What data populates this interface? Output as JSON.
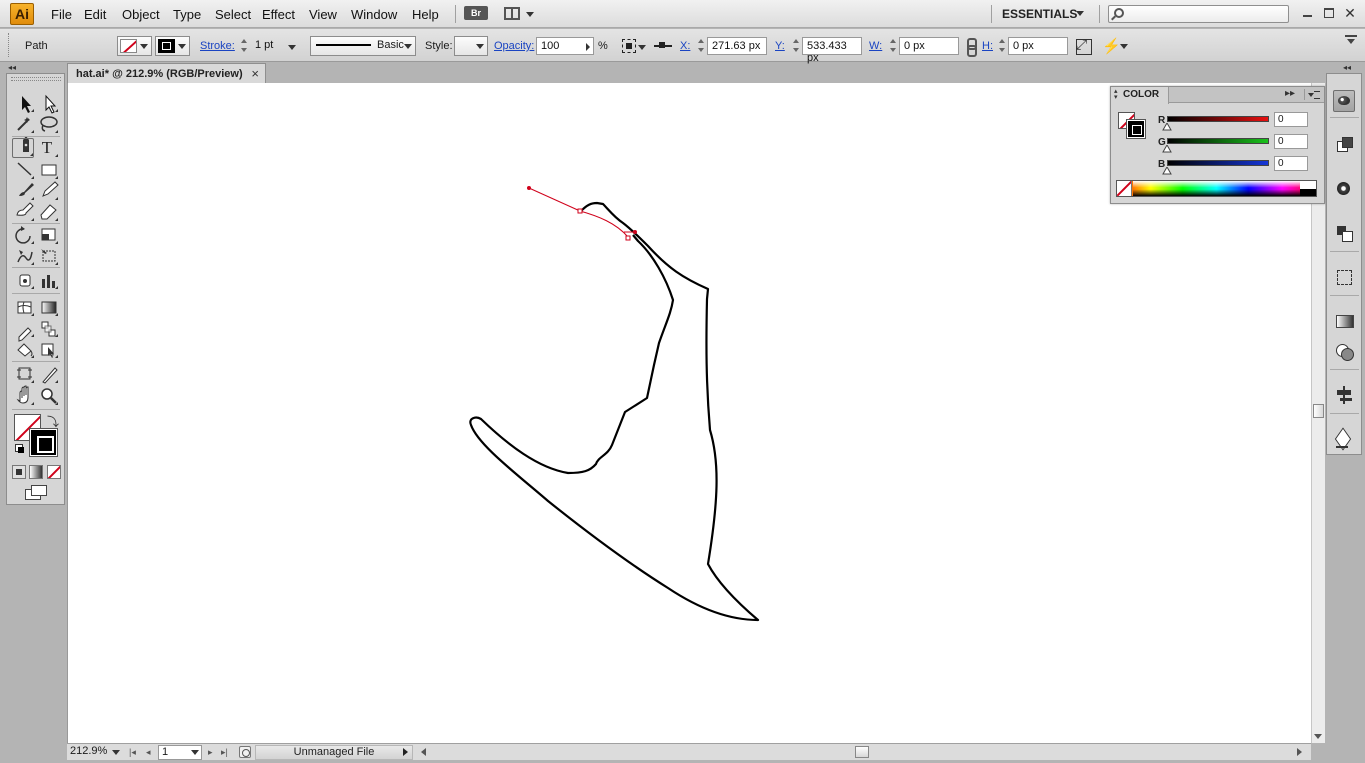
{
  "app": {
    "logo": "Ai",
    "menu": [
      "File",
      "Edit",
      "Object",
      "Type",
      "Select",
      "Effect",
      "View",
      "Window",
      "Help"
    ],
    "bridge_label": "Br",
    "workspace": "ESSENTIALS",
    "search_placeholder": ""
  },
  "control_bar": {
    "selection_type": "Path",
    "stroke_label": "Stroke:",
    "stroke_weight": "1 pt",
    "stroke_profile": "Basic",
    "style_label": "Style:",
    "opacity_label": "Opacity:",
    "opacity_value": "100",
    "opacity_unit": "%",
    "x_label": "X:",
    "x_value": "271.63 px",
    "y_label": "Y:",
    "y_value": "533.433 px",
    "w_label": "W:",
    "w_value": "0 px",
    "h_label": "H:",
    "h_value": "0 px"
  },
  "document": {
    "tab_title": "hat.ai* @ 212.9% (RGB/Preview)",
    "close_glyph": "×"
  },
  "status_bar": {
    "zoom": "212.9%",
    "page": "1",
    "status_text": "Unmanaged File"
  },
  "color_panel": {
    "title": "COLOR",
    "channels": [
      {
        "label": "R",
        "value": "0"
      },
      {
        "label": "G",
        "value": "0"
      },
      {
        "label": "B",
        "value": "0"
      }
    ],
    "colors": {
      "r_max": "#e81010",
      "g_max": "#19c21b",
      "b_max": "#1536d8",
      "none_slash": "#d0021b"
    }
  },
  "tools": [
    "selection-tool",
    "direct-selection-tool",
    "magic-wand-tool",
    "lasso-tool",
    "pen-tool",
    "type-tool",
    "line-segment-tool",
    "rectangle-tool",
    "paintbrush-tool",
    "pencil-tool",
    "blob-brush-tool",
    "eraser-tool",
    "rotate-tool",
    "scale-tool",
    "warp-tool",
    "free-transform-tool",
    "symbol-sprayer-tool",
    "column-graph-tool",
    "mesh-tool",
    "gradient-tool",
    "eyedropper-tool",
    "blend-tool",
    "live-paint-bucket-tool",
    "live-paint-selection-tool",
    "artboard-tool",
    "slice-tool",
    "hand-tool",
    "zoom-tool"
  ],
  "tools_type_glyph": "T",
  "dock_icons": [
    "color",
    "swatches",
    "brushes",
    "symbols",
    "transform",
    "gradient",
    "appearance",
    "align",
    "layers"
  ],
  "selection": {
    "path_color": "#d0021b",
    "fill": "none",
    "stroke": "black"
  }
}
